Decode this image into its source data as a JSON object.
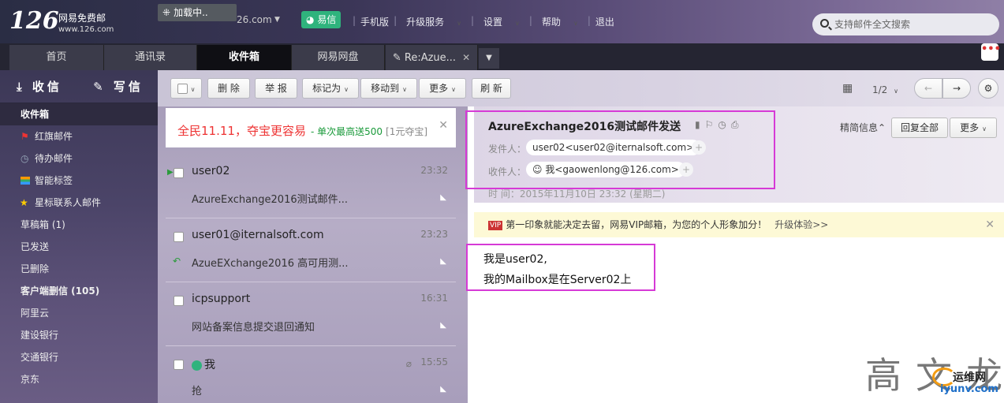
{
  "header": {
    "logo_num": "126",
    "logo_text": "网易免费邮",
    "logo_sub": "www.126.com",
    "loading": "加载中..",
    "account": "26.com",
    "yixin": "易信",
    "links": [
      "手机版",
      "升级服务",
      "设置",
      "帮助",
      "退出"
    ],
    "search_placeholder": "支持邮件全文搜索"
  },
  "tabs": [
    {
      "label": "首页"
    },
    {
      "label": "通讯录"
    },
    {
      "label": "收件箱"
    },
    {
      "label": "网易网盘"
    },
    {
      "label": "Re:Azue..."
    }
  ],
  "sidebar": {
    "receive": "收信",
    "compose": "写信",
    "items": [
      {
        "label": "收件箱"
      },
      {
        "label": "红旗邮件"
      },
      {
        "label": "待办邮件"
      },
      {
        "label": "智能标签"
      },
      {
        "label": "星标联系人邮件"
      },
      {
        "label": "草稿箱 (1)"
      },
      {
        "label": "已发送"
      },
      {
        "label": "已删除"
      },
      {
        "label": "客户端删信 (105)"
      },
      {
        "label": "阿里云"
      },
      {
        "label": "建设银行"
      },
      {
        "label": "交通银行"
      },
      {
        "label": "京东"
      }
    ]
  },
  "toolbar": {
    "delete": "删 除",
    "report": "举 报",
    "mark": "标记为",
    "move": "移动到",
    "more": "更多",
    "refresh": "刷 新",
    "page": "1/2"
  },
  "promo": {
    "text": "全民11.11，夺宝更容易",
    "green": "单次最高送500",
    "grey": "[1元夺宝]"
  },
  "mails": [
    {
      "from": "user02",
      "time": "23:32",
      "subject": "AzureExchange2016测试邮件..."
    },
    {
      "from": "user01@iternalsoft.com",
      "time": "23:23",
      "subject": "AzueEXchange2016 高可用测..."
    },
    {
      "from": "icpsupport",
      "time": "16:31",
      "subject": "网站备案信息提交退回通知"
    },
    {
      "from": "我",
      "time": "15:55",
      "subject": "抢"
    }
  ],
  "reader": {
    "title": "AzureExchange2016测试邮件发送",
    "from_label": "发件人：",
    "from": "user02<user02@iternalsoft.com>",
    "to_label": "收件人：",
    "to": "我<gaowenlong@126.com>",
    "time": "时    间：2015年11月10日 23:32 (星期二)",
    "brief": "精简信息",
    "reply_all": "回复全部",
    "more": "更多",
    "vip_badge": "VIP",
    "vip_text": "第一印象就能决定去留，网易VIP邮箱，为您的个人形象加分！",
    "vip_link": "升级体验>>",
    "body_line1": "我是user02,",
    "body_line2": "我的Mailbox是在Server02上"
  },
  "watermark": {
    "text": "高文龙",
    "logo_cn": "运维网",
    "logo_en": "iyunv.com"
  },
  "colors": {
    "highlight": "#d63ad6",
    "accent_green": "#2fb37d",
    "promo_red": "#e33333"
  }
}
